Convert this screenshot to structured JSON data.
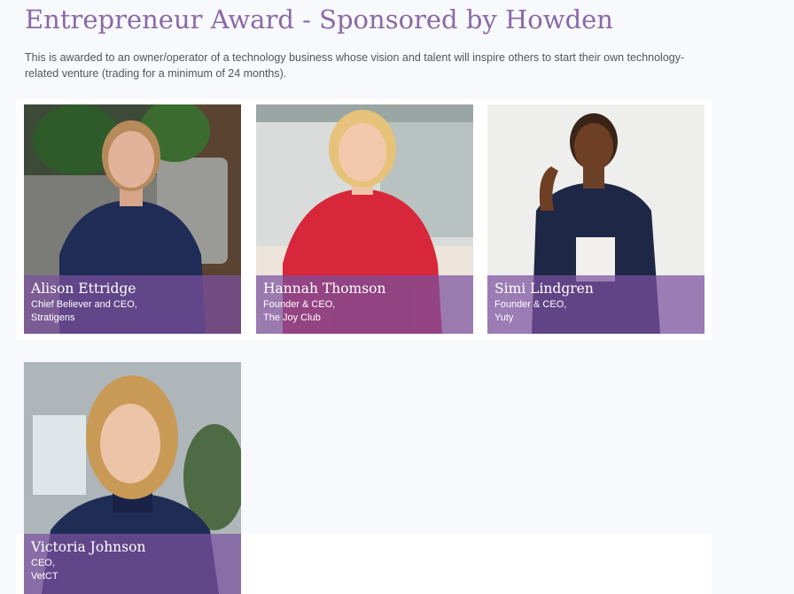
{
  "award": {
    "title": "Entrepreneur Award - Sponsored by Howden",
    "description": "This is awarded to an owner/operator of a technology business whose vision and talent will inspire others to start their own technology-related venture (trading for a minimum of 24 months)."
  },
  "nominees": [
    {
      "name": "Alison Ettridge",
      "role": "Chief Believer and CEO,",
      "company": "Stratigens"
    },
    {
      "name": "Hannah Thomson",
      "role": "Founder & CEO,",
      "company": "The Joy Club"
    },
    {
      "name": "Simi Lindgren",
      "role": "Founder & CEO,",
      "company": "Yuty"
    },
    {
      "name": "Victoria Johnson",
      "role": "CEO,",
      "company": "VetCT"
    }
  ],
  "colors": {
    "title": "#8a6aa6",
    "overlay": "#7c50a0",
    "page_background": "#f8f9fc"
  }
}
